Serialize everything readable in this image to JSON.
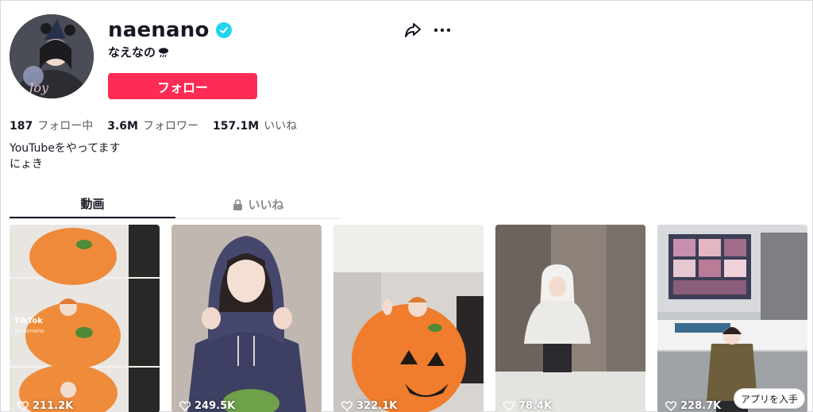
{
  "profile": {
    "username": "naenano",
    "nickname": "なえなの",
    "follow_label": "フォロー"
  },
  "stats": [
    {
      "value": "187",
      "label": "フォロー中"
    },
    {
      "value": "3.6M",
      "label": "フォロワー"
    },
    {
      "value": "157.1M",
      "label": "いいね"
    }
  ],
  "bio": [
    "YouTubeをやってます",
    "にょき"
  ],
  "tabs": [
    {
      "label": "動画",
      "active": true,
      "icon": ""
    },
    {
      "label": "いいね",
      "active": false,
      "icon": "lock-icon"
    }
  ],
  "videos": [
    {
      "views": "211.2K",
      "watermark": "TikTok",
      "watermark_handle": "@naenano"
    },
    {
      "views": "249.5K"
    },
    {
      "views": "322.1K"
    },
    {
      "views": "78.4K"
    },
    {
      "views": "228.7K"
    }
  ],
  "app_badge": "アプリを入手",
  "colors": {
    "accent": "#fe2c55",
    "verified": "#20d5ec"
  }
}
